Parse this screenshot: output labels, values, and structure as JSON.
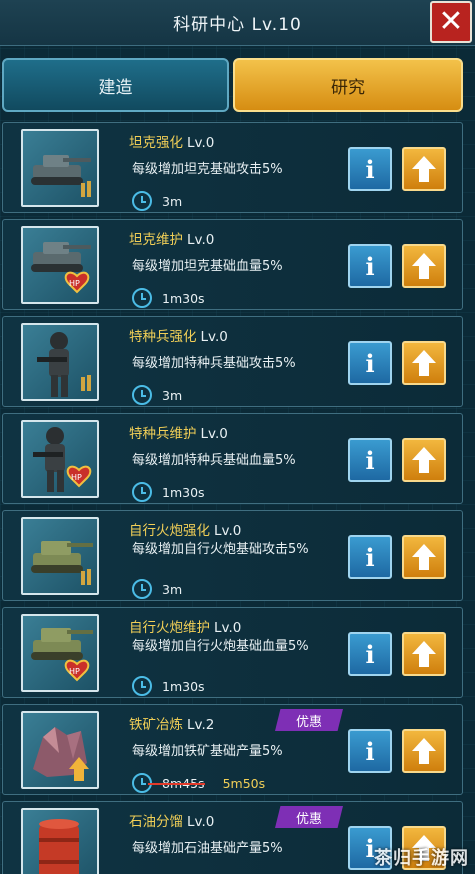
{
  "header": {
    "title": "科研中心 Lv.10",
    "close_label": "✕"
  },
  "tabs": [
    {
      "label": "建造",
      "active": false
    },
    {
      "label": "研究",
      "active": true
    }
  ],
  "research_items": [
    {
      "name": "坦克强化",
      "level": "Lv.0",
      "desc": "每级增加坦克基础攻击5%",
      "time": "3m",
      "icon": "tank-attack-icon"
    },
    {
      "name": "坦克维护",
      "level": "Lv.0",
      "desc": "每级增加坦克基础血量5%",
      "time": "1m30s",
      "icon": "tank-hp-icon"
    },
    {
      "name": "特种兵强化",
      "level": "Lv.0",
      "desc": "每级增加特种兵基础攻击5%",
      "time": "3m",
      "icon": "soldier-attack-icon"
    },
    {
      "name": "特种兵维护",
      "level": "Lv.0",
      "desc": "每级增加特种兵基础血量5%",
      "time": "1m30s",
      "icon": "soldier-hp-icon"
    },
    {
      "name": "自行火炮强化",
      "level": "Lv.0",
      "desc": "每级增加自行火炮基础攻击5%",
      "time": "3m",
      "icon": "artillery-attack-icon"
    },
    {
      "name": "自行火炮维护",
      "level": "Lv.0",
      "desc": "每级增加自行火炮基础血量5%",
      "time": "1m30s",
      "icon": "artillery-hp-icon"
    },
    {
      "name": "铁矿冶炼",
      "level": "Lv.2",
      "desc": "每级增加铁矿基础产量5%",
      "time": "8m45s",
      "discount_time": "5m50s",
      "badge": "优惠",
      "icon": "iron-ore-icon"
    },
    {
      "name": "石油分馏",
      "level": "Lv.0",
      "desc": "每级增加石油基础产量5%",
      "time": "",
      "badge": "优惠",
      "icon": "oil-barrel-icon"
    }
  ],
  "buttons": {
    "info_label": "i"
  },
  "watermark": "茶归手游网",
  "colors": {
    "accent_gold": "#f1cf57",
    "tab_active": "#e8a52a",
    "info_blue": "#2a7fb8",
    "upgrade_orange": "#e09a1e",
    "badge_purple": "#7e2fb5"
  }
}
